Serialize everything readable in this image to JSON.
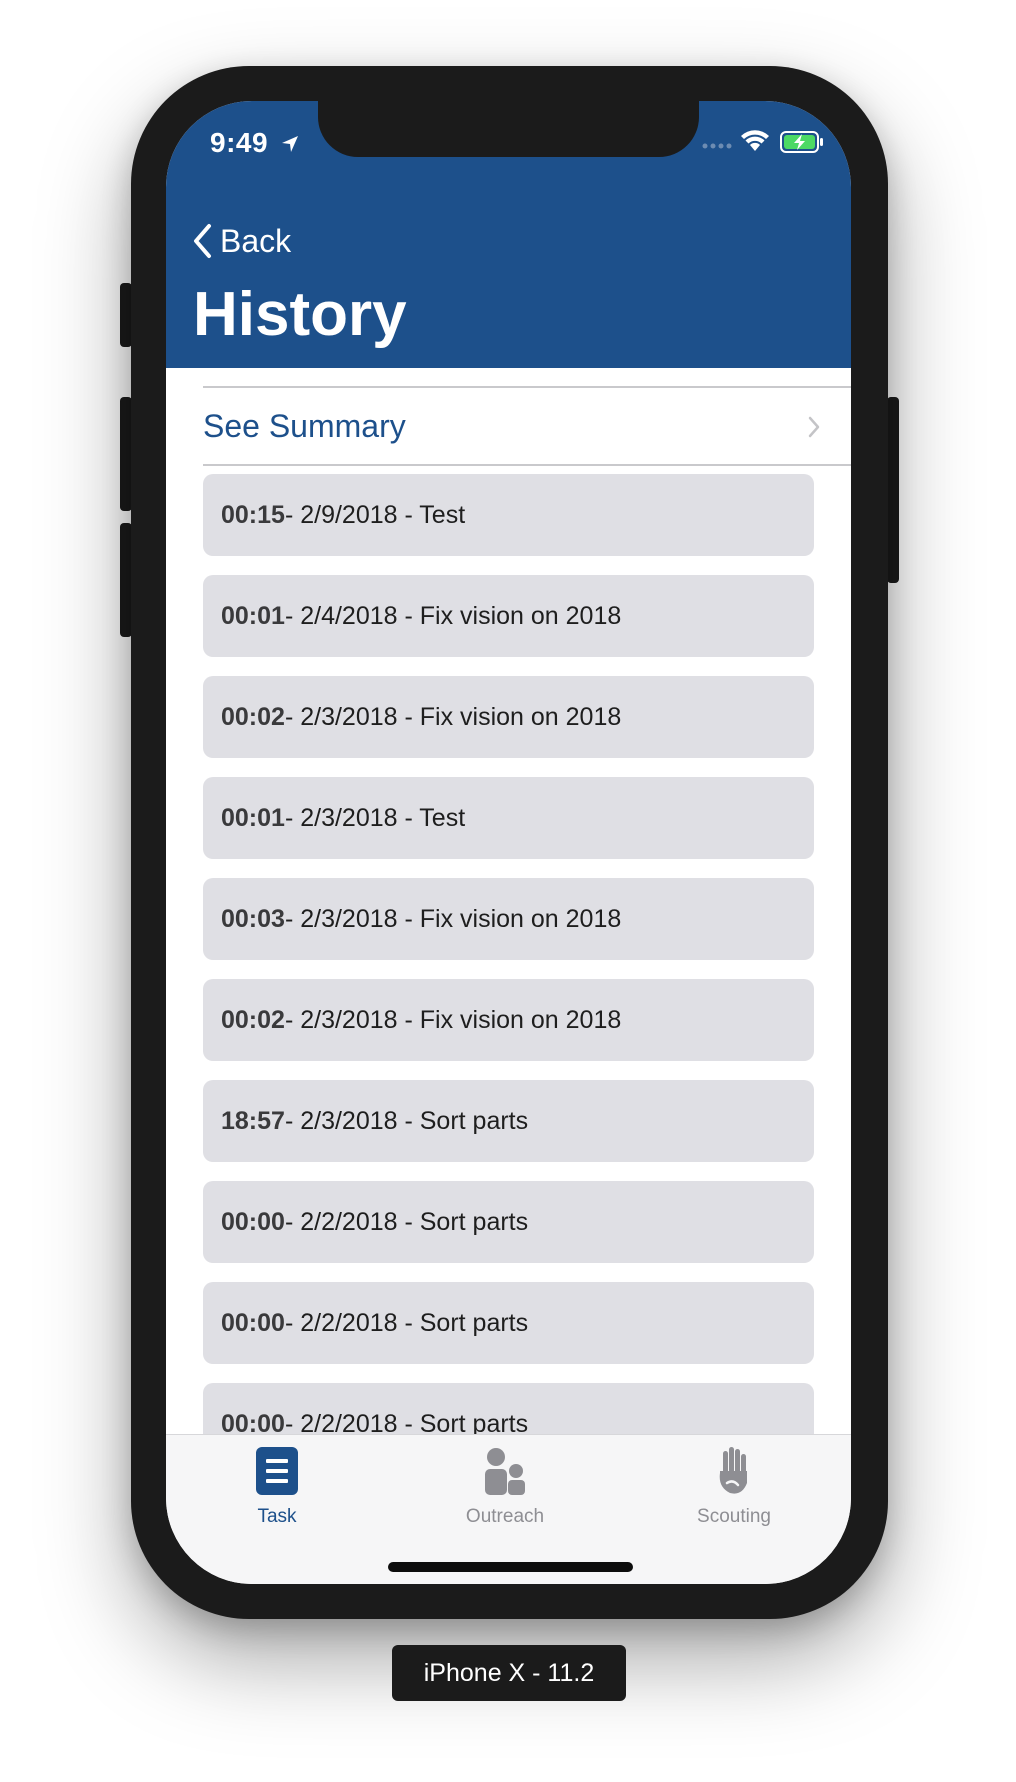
{
  "status_bar": {
    "time": "9:49"
  },
  "nav": {
    "back_label": "Back",
    "title": "History"
  },
  "summary": {
    "label": "See Summary"
  },
  "history_items": [
    {
      "duration": "00:15",
      "rest": " - 2/9/2018 - Test"
    },
    {
      "duration": "00:01",
      "rest": " - 2/4/2018 - Fix vision on 2018"
    },
    {
      "duration": "00:02",
      "rest": " - 2/3/2018 - Fix vision on 2018"
    },
    {
      "duration": "00:01",
      "rest": " - 2/3/2018 - Test"
    },
    {
      "duration": "00:03",
      "rest": " - 2/3/2018 - Fix vision on 2018"
    },
    {
      "duration": "00:02",
      "rest": " - 2/3/2018 - Fix vision on 2018"
    },
    {
      "duration": "18:57",
      "rest": " - 2/3/2018 - Sort parts"
    },
    {
      "duration": "00:00",
      "rest": " - 2/2/2018 - Sort parts"
    },
    {
      "duration": "00:00",
      "rest": " - 2/2/2018 - Sort parts"
    },
    {
      "duration": "00:00",
      "rest": " - 2/2/2018 - Sort parts"
    }
  ],
  "tabs": [
    {
      "label": "Task",
      "icon": "list-icon",
      "active": true
    },
    {
      "label": "Outreach",
      "icon": "people-icon",
      "active": false
    },
    {
      "label": "Scouting",
      "icon": "hand-icon",
      "active": false
    }
  ],
  "device_label": "iPhone X - 11.2",
  "colors": {
    "brand": "#1d508b",
    "item_bg": "#dfdfe4",
    "inactive_tab": "#8e8e93"
  }
}
